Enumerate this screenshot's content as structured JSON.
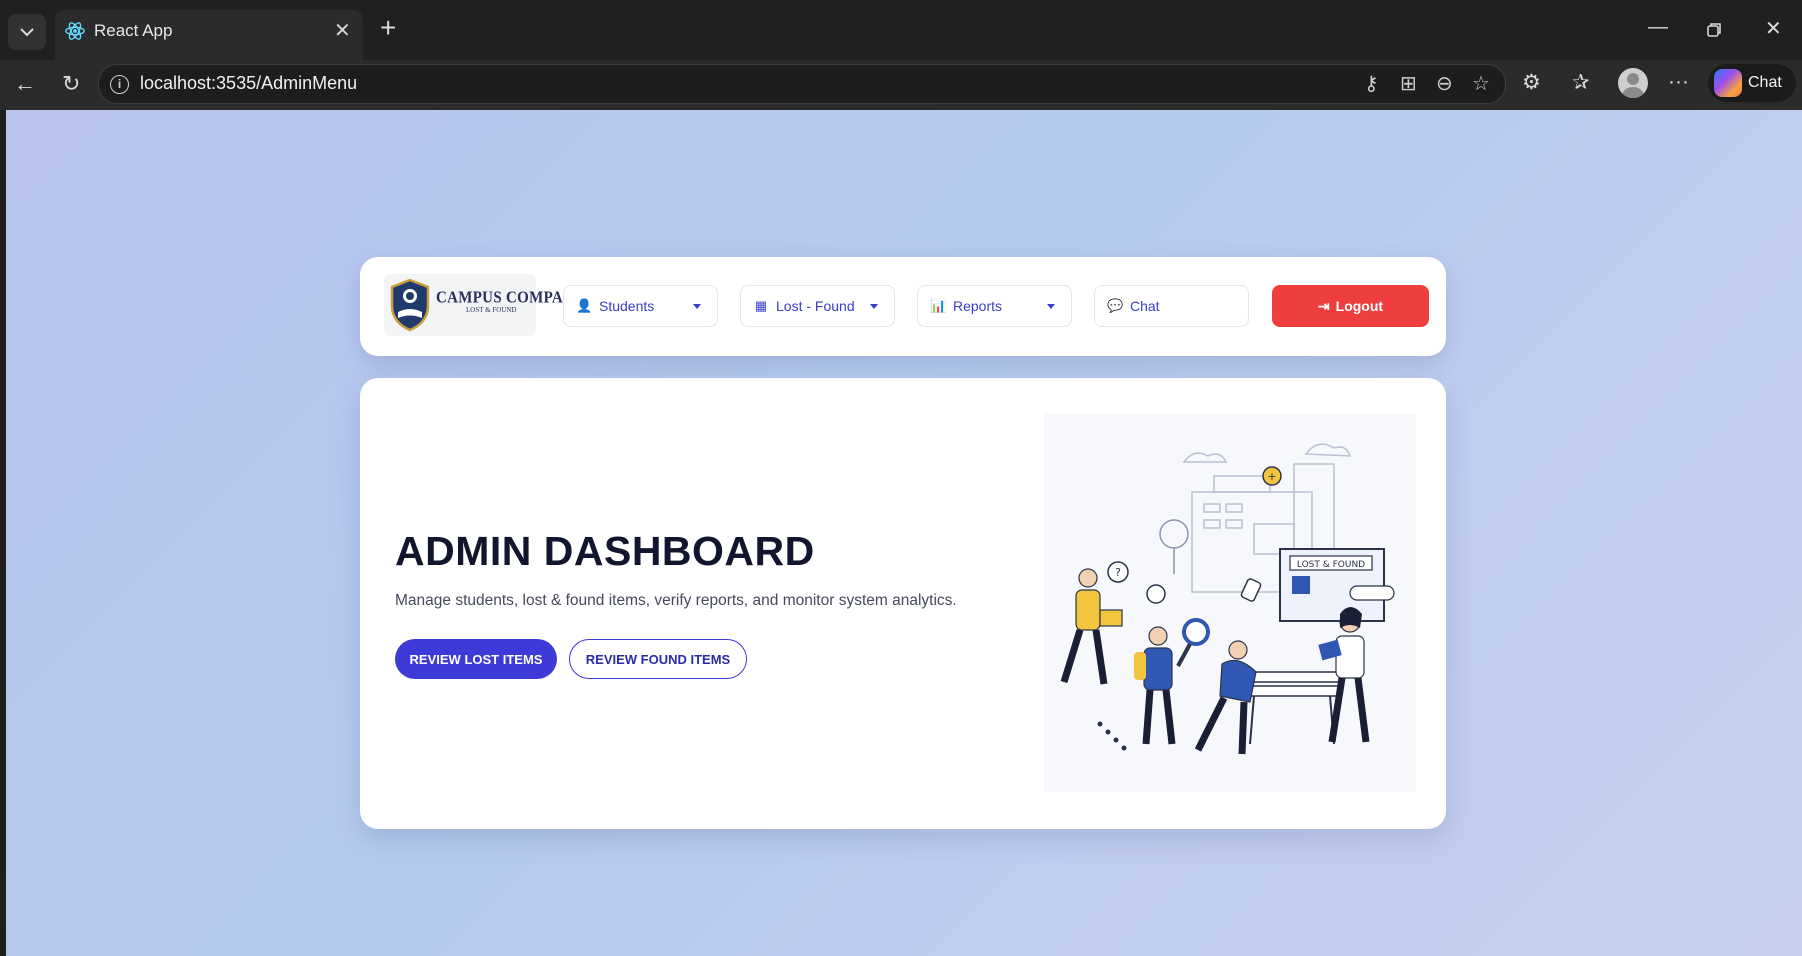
{
  "browser": {
    "tab_title": "React App",
    "url": "localhost:3535/AdminMenu",
    "chat_label": "Chat",
    "icons": [
      "chevron-down-icon",
      "react-icon",
      "close-icon",
      "plus-icon",
      "minimize-icon",
      "restore-icon",
      "close-window-icon",
      "back-icon",
      "refresh-icon",
      "info-icon",
      "key-icon",
      "apps-icon",
      "zoom-icon",
      "star-icon",
      "extensions-icon",
      "favorites-icon",
      "profile-icon",
      "more-icon",
      "copilot-icon"
    ]
  },
  "nav": {
    "logo": {
      "title": "CAMPUS COMPASS",
      "subtitle": "LOST & FOUND"
    },
    "students_label": "Students",
    "lost_found_label": "Lost - Found",
    "reports_label": "Reports",
    "chat_label": "Chat",
    "logout_label": "Logout"
  },
  "hero": {
    "title": "ADMIN DASHBOARD",
    "subtitle": "Manage students, lost & found items, verify reports, and monitor system analytics.",
    "primary_button": "REVIEW LOST ITEMS",
    "secondary_button": "REVIEW FOUND ITEMS",
    "illustration_sign": "LOST & FOUND"
  },
  "colors": {
    "accent": "#3d3ad7",
    "logout": "#ef3e3e",
    "background": "#b8c4ef"
  }
}
